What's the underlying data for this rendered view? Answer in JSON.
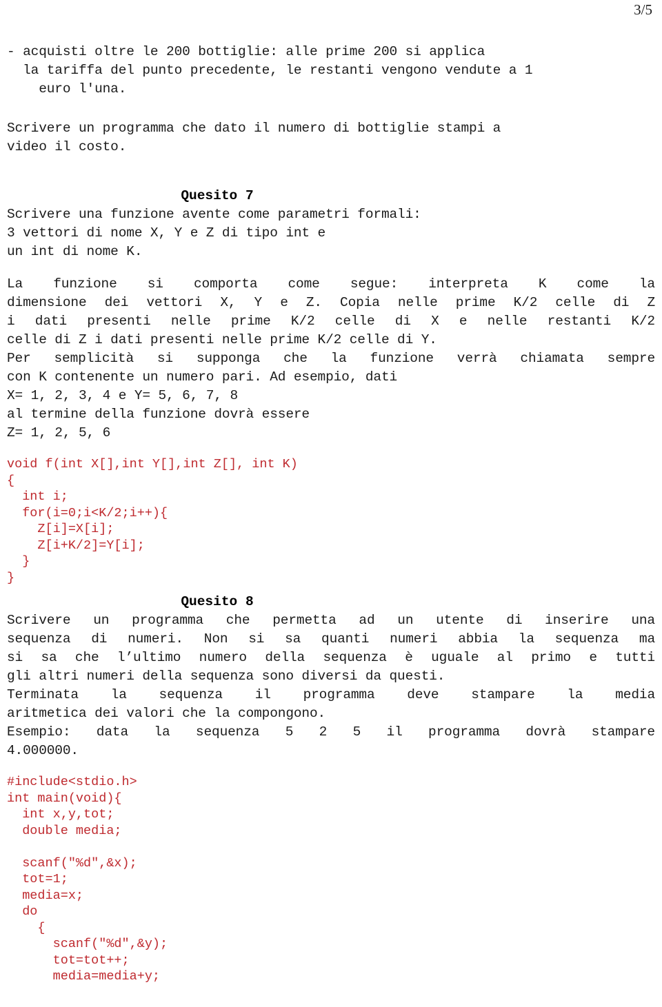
{
  "page": {
    "number_label": "3/5",
    "accent_code_color": "#bf2a2f",
    "text_color": "#1b1b1b"
  },
  "bullet_item": {
    "line1": "- acquisti oltre le 200 bottiglie: alle prime 200 si applica",
    "line2": "  la tariffa del punto precedente, le restanti vengono vendute a 1",
    "line3": "    euro l'una."
  },
  "intro_paragraph": {
    "line1": "Scrivere un programma che dato il numero di bottiglie stampi a",
    "line2": "video il costo."
  },
  "quesito7": {
    "heading": "Quesito 7",
    "intro_line1": "Scrivere una funzione avente come parametri formali:",
    "intro_line2": "3 vettori di nome X, Y e Z di tipo int e",
    "intro_line3": "un int di nome K.",
    "body_justified_1": "La funzione si comporta come segue: interpreta K come la",
    "body_justified_2": "dimensione dei vettori X, Y e Z. Copia nelle prime K/2 celle di Z",
    "body_justified_3": "i dati presenti nelle prime K/2 celle di X e nelle restanti K/2",
    "body_line_4": "celle di Z i dati presenti nelle prime K/2 celle di Y.",
    "body_justified_5": "Per semplicità si supponga che la funzione verrà chiamata sempre",
    "body_line_6": "con K contenente un numero pari. Ad esempio, dati",
    "body_line_7": "X= 1, 2, 3, 4 e Y= 5, 6, 7, 8",
    "body_line_8": "al termine della funzione dovrà essere",
    "body_line_9": "Z= 1, 2, 5, 6",
    "code_lines": [
      "void f(int X[],int Y[],int Z[], int K)",
      "{",
      "  int i;",
      "  for(i=0;i<K/2;i++){",
      "    Z[i]=X[i];",
      "    Z[i+K/2]=Y[i];",
      "  }",
      "}"
    ]
  },
  "quesito8": {
    "heading": "Quesito 8",
    "body_justified_1": "Scrivere un programma che permetta ad un utente di inserire una",
    "body_justified_2": "sequenza di numeri. Non si sa quanti numeri abbia la sequenza ma",
    "body_justified_3": "si sa che l’ultimo numero della sequenza è uguale al primo e tutti",
    "body_line_4": "gli altri numeri della sequenza sono diversi da questi.",
    "body_justified_5": "Terminata la sequenza il programma deve stampare la media",
    "body_line_6": "aritmetica dei valori che la compongono.",
    "body_justified_7": "Esempio: data la sequenza 5 2 5 il programma dovrà stampare",
    "body_line_8": "4.000000.",
    "code_lines": [
      "#include<stdio.h>",
      "int main(void){",
      "  int x,y,tot;",
      "  double media;",
      "",
      "  scanf(\"%d\",&x);",
      "  tot=1;",
      "  media=x;",
      "  do",
      "    {",
      "      scanf(\"%d\",&y);",
      "      tot=tot++;",
      "      media=media+y;"
    ]
  }
}
